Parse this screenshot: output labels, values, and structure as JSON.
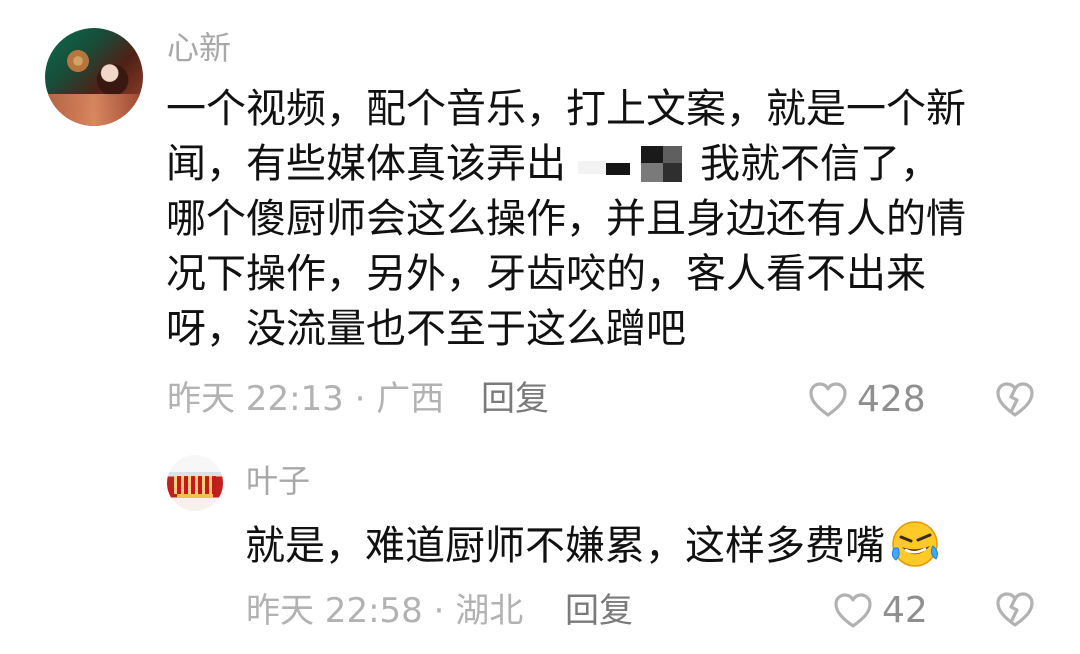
{
  "comment": {
    "author": "心新",
    "avatar_icon": "woman-photo-avatar",
    "lines": {
      "l1": "一个视频，配个音乐，打上文案，就是一个新",
      "l2_before": "闻，有些媒体真该弄出",
      "l2_after": "我就不信了，",
      "l3": "哪个傻厨师会这么操作，并且身边还有人的情",
      "l4": "况下操作，另外，牙齿咬的，客人看不出来",
      "l5": "呀，没流量也不至于这么蹭吧"
    },
    "meta": "昨天 22:13 · 广西",
    "reply_label": "回复",
    "likes": "428",
    "like_icon": "heart-outline-icon",
    "dislike_icon": "broken-heart-icon"
  },
  "reply": {
    "author": "叶子",
    "avatar_icon": "red-building-avatar",
    "text": "就是，难道厨师不嫌累，这样多费嘴",
    "emoji_icon": "laughing-crying-emoji",
    "meta": "昨天 22:58 · 湖北",
    "reply_label": "回复",
    "likes": "42",
    "like_icon": "heart-outline-icon",
    "dislike_icon": "broken-heart-icon"
  },
  "colors": {
    "text": "#111111",
    "secondary": "#a8a8a8",
    "reply_button": "#7a7a7a",
    "icon": "#b2b2b2",
    "emoji": "#f5b800"
  }
}
